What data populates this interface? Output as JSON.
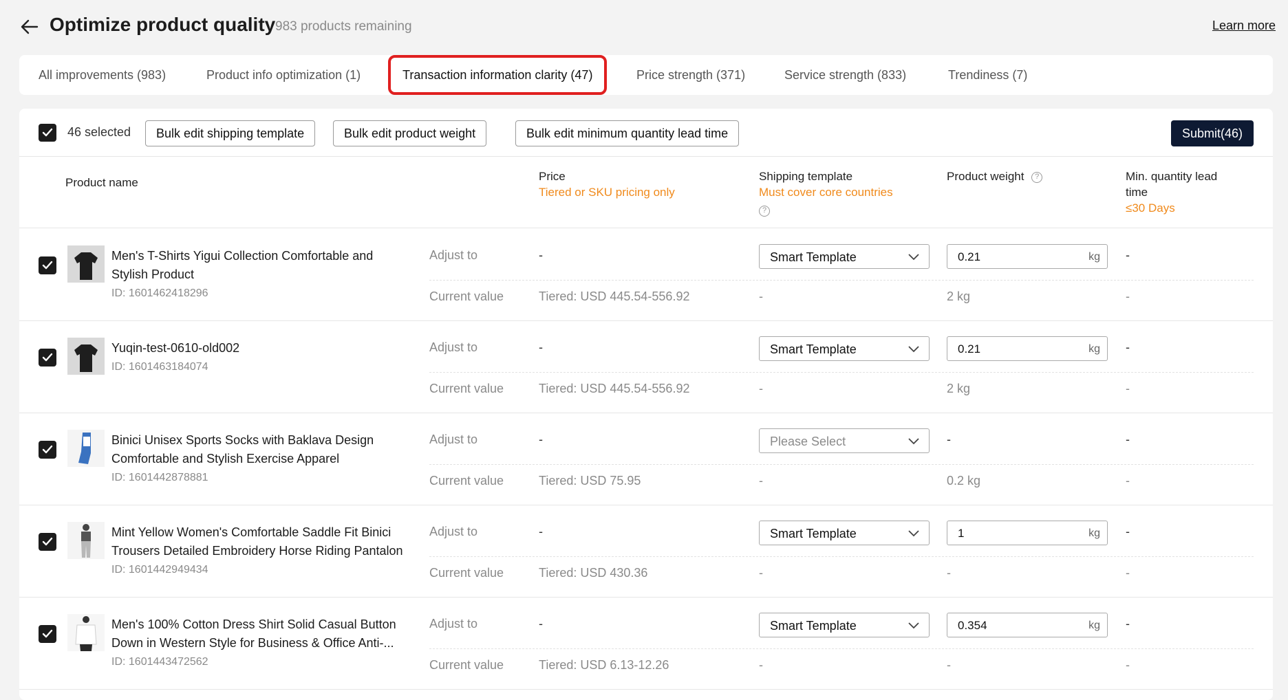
{
  "header": {
    "title": "Optimize product quality",
    "remaining": "983 products remaining",
    "learn_more": "Learn more"
  },
  "tabs": [
    {
      "label": "All improvements (983)"
    },
    {
      "label": "Product info optimization (1)"
    },
    {
      "label": "Transaction information clarity (47)",
      "active": true
    },
    {
      "label": "Price strength (371)"
    },
    {
      "label": "Service strength (833)"
    },
    {
      "label": "Trendiness (7)"
    }
  ],
  "toolbar": {
    "selected": "46 selected",
    "bulk_shipping": "Bulk edit shipping template",
    "bulk_weight": "Bulk edit product weight",
    "bulk_lead": "Bulk edit minimum quantity lead time",
    "submit": "Submit(46)"
  },
  "columns": {
    "product_name": "Product name",
    "price": "Price",
    "price_note": "Tiered or SKU pricing only",
    "shipping": "Shipping template",
    "shipping_note": "Must cover core countries",
    "weight": "Product weight",
    "lead_time_line1": "Min. quantity lead",
    "lead_time_line2": "time",
    "lead_time_note": "≤30 Days"
  },
  "labels": {
    "adjust_to": "Adjust to",
    "current_value": "Current value"
  },
  "rows": [
    {
      "name": "Men's T-Shirts Yigui Collection Comfortable and Stylish Product",
      "id": "ID: 1601462418296",
      "adjust_price": "-",
      "shipping_select": "Smart Template",
      "weight_input": "0.21",
      "weight_unit": "kg",
      "adjust_lead": "-",
      "current_price": "Tiered: USD 445.54-556.92",
      "current_shipping": "-",
      "current_weight": "2 kg",
      "current_lead": "-"
    },
    {
      "name": "Yuqin-test-0610-old002",
      "id": "ID: 1601463184074",
      "adjust_price": "-",
      "shipping_select": "Smart Template",
      "weight_input": "0.21",
      "weight_unit": "kg",
      "adjust_lead": "-",
      "current_price": "Tiered: USD 445.54-556.92",
      "current_shipping": "-",
      "current_weight": "2 kg",
      "current_lead": "-"
    },
    {
      "name": "Binici Unisex Sports Socks with Baklava Design Comfortable and Stylish Exercise Apparel",
      "id": "ID: 1601442878881",
      "adjust_price": "-",
      "shipping_select": "Please Select",
      "adjust_weight": "-",
      "adjust_lead": "-",
      "current_price": "Tiered: USD 75.95",
      "current_shipping": "-",
      "current_weight": "0.2 kg",
      "current_lead": "-"
    },
    {
      "name": "Mint Yellow Women's Comfortable Saddle Fit Binici Trousers Detailed Embroidery Horse Riding Pantalon",
      "id": "ID: 1601442949434",
      "adjust_price": "-",
      "shipping_select": "Smart Template",
      "weight_input": "1",
      "weight_unit": "kg",
      "adjust_lead": "-",
      "current_price": "Tiered: USD 430.36",
      "current_shipping": "-",
      "current_weight": "-",
      "current_lead": "-"
    },
    {
      "name": "Men's 100% Cotton Dress Shirt Solid Casual Button Down in Western Style for Business & Office Anti-...",
      "id": "ID: 1601443472562",
      "adjust_price": "-",
      "shipping_select": "Smart Template",
      "weight_input": "0.354",
      "weight_unit": "kg",
      "adjust_lead": "-",
      "current_price": "Tiered: USD 6.13-12.26",
      "current_shipping": "-",
      "current_weight": "-",
      "current_lead": "-"
    }
  ],
  "colors": {
    "accent_orange": "#f08a1c",
    "submit_bg": "#0e1a33",
    "highlight_red": "#e02020"
  }
}
